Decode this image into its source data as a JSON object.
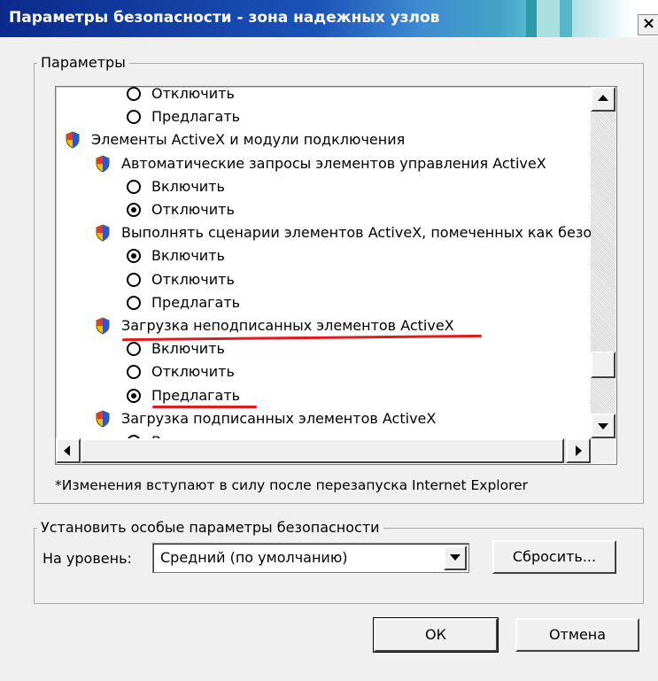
{
  "window": {
    "title": "Параметры безопасности - зона надежных узлов",
    "close_glyph": "×",
    "titlebar_color": "#0b2a8c"
  },
  "params_group": {
    "label": "Параметры",
    "items": [
      {
        "kind": "radio",
        "label": "Отключить",
        "checked": false
      },
      {
        "kind": "radio",
        "label": "Предлагать",
        "checked": false
      },
      {
        "kind": "category",
        "label": "Элементы ActiveX и модули подключения",
        "icon": "shield-icon"
      },
      {
        "kind": "setting",
        "label": "Автоматические запросы элементов управления ActiveX",
        "icon": "shield-icon"
      },
      {
        "kind": "radio",
        "label": "Включить",
        "checked": false
      },
      {
        "kind": "radio",
        "label": "Отключить",
        "checked": true
      },
      {
        "kind": "setting",
        "label": "Выполнять сценарии элементов ActiveX, помеченных как безопасные",
        "icon": "shield-icon"
      },
      {
        "kind": "radio",
        "label": "Включить",
        "checked": true
      },
      {
        "kind": "radio",
        "label": "Отключить",
        "checked": false
      },
      {
        "kind": "radio",
        "label": "Предлагать",
        "checked": false
      },
      {
        "kind": "setting",
        "label": "Загрузка неподписанных элементов ActiveX",
        "icon": "shield-icon"
      },
      {
        "kind": "radio",
        "label": "Включить",
        "checked": false
      },
      {
        "kind": "radio",
        "label": "Отключить",
        "checked": false
      },
      {
        "kind": "radio",
        "label": "Предлагать",
        "checked": true
      },
      {
        "kind": "setting",
        "label": "Загрузка подписанных элементов ActiveX",
        "icon": "shield-icon"
      },
      {
        "kind": "radio",
        "label": "Включить",
        "checked": false
      }
    ],
    "note": "*Изменения вступают в силу после перезапуска Internet Explorer"
  },
  "custom_group": {
    "label": "Установить особые параметры безопасности",
    "level_label": "На уровень:",
    "level_value": "Средний (по умолчанию)",
    "reset_button": "Сбросить..."
  },
  "buttons": {
    "ok": "ОК",
    "cancel": "Отмена"
  },
  "annotation_color": "#e01b1b"
}
